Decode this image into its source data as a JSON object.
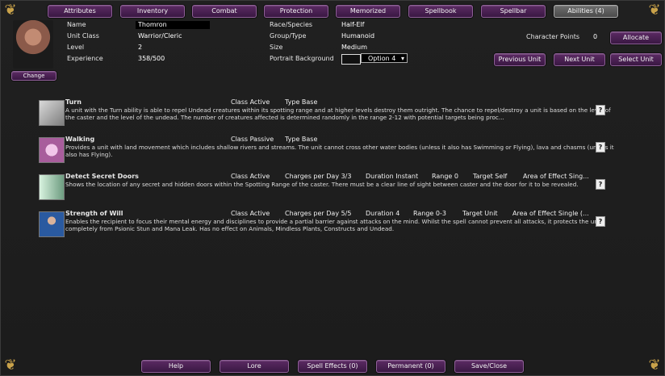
{
  "tabs": [
    "Attributes",
    "Inventory",
    "Combat",
    "Protection",
    "Memorized",
    "Spellbook",
    "Spellbar",
    "Abilities (4)"
  ],
  "portrait": {
    "change_label": "Change"
  },
  "labels": {
    "name": "Name",
    "unit_class": "Unit Class",
    "level": "Level",
    "experience": "Experience",
    "race": "Race/Species",
    "group": "Group/Type",
    "size": "Size",
    "portrait_bg": "Portrait Background"
  },
  "values": {
    "name": "Thomron",
    "unit_class": "Warrior/Cleric",
    "level": "2",
    "experience": "358/500",
    "race": "Half-Elf",
    "group": "Humanoid",
    "size": "Medium",
    "portrait_option": "Option 4"
  },
  "character_points": {
    "label": "Character Points",
    "value": "0",
    "button": "Allocate"
  },
  "unit_buttons": [
    "Previous Unit",
    "Next Unit",
    "Select Unit"
  ],
  "abilities": [
    {
      "title": "Turn",
      "class": "Class Active",
      "type": "Type Base",
      "desc": "A unit with the Turn ability is able to repel Undead creatures within its spotting range and at higher levels destroy them outright. The chance to repel/destroy a unit is based on the level of the caster and the level of the undead. The number of creatures affected is determined randomly in the range 2-12 with potential targets being proc..."
    },
    {
      "title": "Walking",
      "class": "Class Passive",
      "type": "Type Base",
      "desc": "Provides a unit with land movement which includes shallow rivers and streams. The unit cannot cross other water bodies (unless it also has Swimming or Flying), lava and chasms (unless it also has Flying)."
    },
    {
      "title": "Detect Secret Doors",
      "class": "Class Active",
      "charges": "Charges per Day 3/3",
      "duration": "Duration Instant",
      "range": "Range 0",
      "target": "Target Self",
      "aoe": "Area of Effect Sing...",
      "desc": "Shows the location of any secret and hidden doors within the Spotting Range of the caster. There must be a clear line of sight between caster and the door for it to be revealed."
    },
    {
      "title": "Strength of Will",
      "class": "Class Active",
      "charges": "Charges per Day 5/5",
      "duration": "Duration 4",
      "range": "Range 0-3",
      "target": "Target Unit",
      "aoe": "Area of Effect Single (...",
      "desc": "Enables the recipient to focus their mental energy and disciplines to provide a partial barrier against attacks on the mind. Whilst the spell cannot prevent all attacks, it protects the unit completely from Psionic Stun and Mana Leak. Has no effect on Animals, Mindless Plants, Constructs and Undead."
    }
  ],
  "help_glyph": "?",
  "bottom_buttons": [
    "Help",
    "Lore",
    "Spell Effects (0)",
    "Permanent (0)",
    "Save/Close"
  ]
}
